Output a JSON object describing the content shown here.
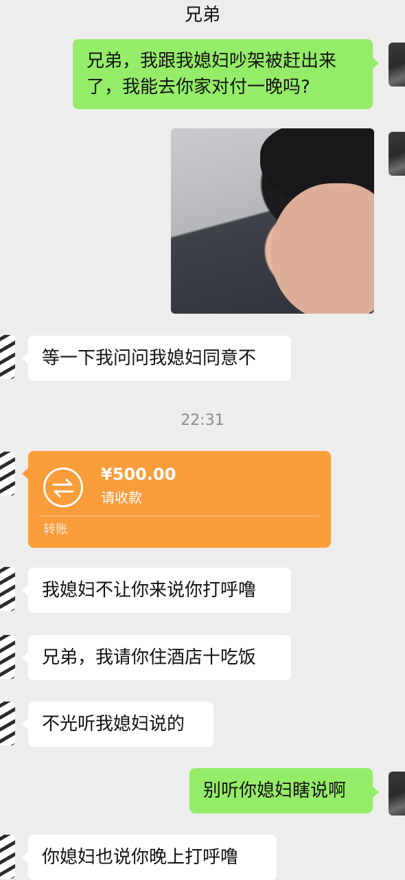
{
  "header": {
    "title": "兄弟"
  },
  "messages": {
    "m1": "兄弟，我跟我媳妇吵架被赶出来了，我能去你家对付一晚吗?",
    "m2": "等一下我问问我媳妇同意不",
    "time": "22:31",
    "transfer": {
      "amount": "¥500.00",
      "note": "请收款",
      "type": "转账"
    },
    "m3": "我媳妇不让你来说你打呼噜",
    "m4": "兄弟，我请你住酒店十吃饭",
    "m5": "不光听我媳妇说的",
    "m6": "别听你媳妇瞎说啊",
    "m7": "你媳妇也说你晚上打呼噜"
  },
  "colors": {
    "sent_bubble": "#95ec69",
    "received_bubble": "#ffffff",
    "transfer": "#fa9d3b",
    "background": "#ededed"
  }
}
